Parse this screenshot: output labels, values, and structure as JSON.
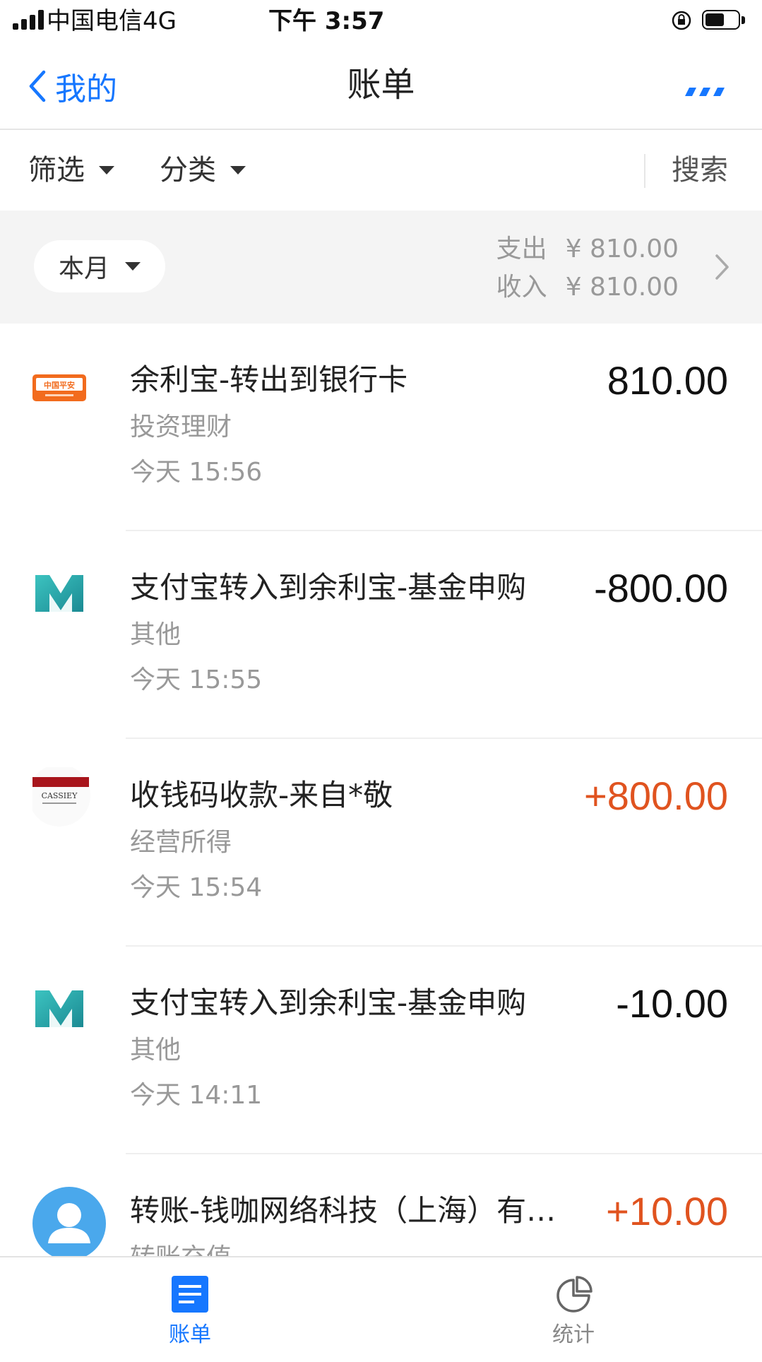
{
  "status_bar": {
    "carrier": "中国电信",
    "network": "4G",
    "time": "下午 3:57"
  },
  "nav": {
    "back_label": "我的",
    "title": "账单"
  },
  "filter_bar": {
    "filter_label": "筛选",
    "category_label": "分类",
    "search_label": "搜索"
  },
  "month_bar": {
    "month_label": "本月",
    "expense_label": "支出",
    "expense_amount": "¥ 810.00",
    "income_label": "收入",
    "income_amount": "¥ 810.00"
  },
  "transactions": [
    {
      "title": "余利宝-转出到银行卡",
      "category": "投资理财",
      "time": "今天  15:56",
      "amount": "810.00",
      "logo": "ping-an-bank-logo",
      "logo_text": "中国平安",
      "type": "neutral"
    },
    {
      "title": "支付宝转入到余利宝-基金申购",
      "category": "其他",
      "time": "今天  15:55",
      "amount": "-800.00",
      "logo": "mybank-logo",
      "type": "neutral"
    },
    {
      "title": "收钱码收款-来自*敬",
      "category": "经营所得",
      "time": "今天  15:54",
      "amount": "+800.00",
      "logo": "cassiey-logo",
      "logo_text": "CASSIEY",
      "type": "income"
    },
    {
      "title": "支付宝转入到余利宝-基金申购",
      "category": "其他",
      "time": "今天  14:11",
      "amount": "-10.00",
      "logo": "mybank-logo",
      "type": "neutral"
    },
    {
      "title": "转账-钱咖网络科技（上海）有…",
      "category": "转账充值",
      "time": "",
      "amount": "+10.00",
      "logo": "user-avatar-icon",
      "type": "income"
    }
  ],
  "tab_bar": {
    "tabs": [
      {
        "label": "账单",
        "icon": "bill-list-icon",
        "active": true
      },
      {
        "label": "统计",
        "icon": "pie-chart-icon",
        "active": false
      }
    ]
  },
  "colors": {
    "accent_blue": "#1677ff",
    "income_orange": "#e0531f",
    "muted_gray": "#999999",
    "section_bg": "#f4f4f4"
  }
}
